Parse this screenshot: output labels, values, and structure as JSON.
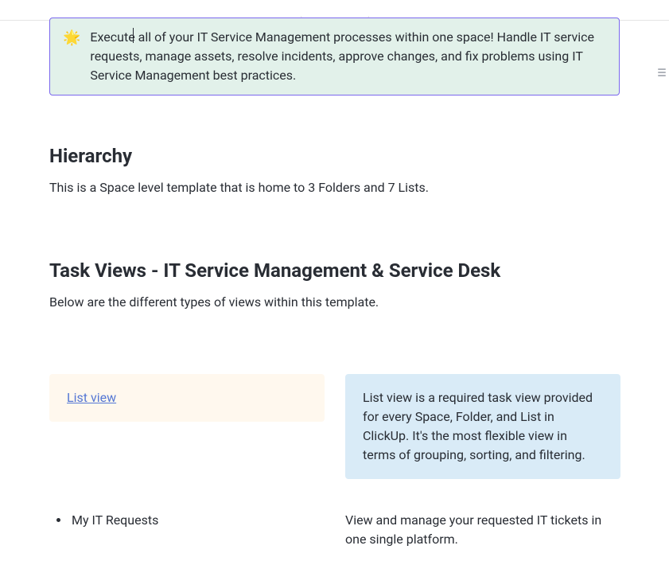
{
  "callout": {
    "icon": "🌟",
    "text": "Execute all of your IT Service Management processes within one space! Handle IT service requests, manage assets, resolve incidents, approve changes, and fix problems using IT Service Management best practices."
  },
  "hierarchy": {
    "heading": "Hierarchy",
    "body": "This is a Space level template that is home to 3 Folders and 7 Lists."
  },
  "taskviews": {
    "heading": "Task Views - IT Service Management & Service Desk",
    "body": "Below are the different types of views within this template."
  },
  "listview_card": {
    "link_label": "List view",
    "description": "List view is a required task view provided for every Space, Folder, and List in ClickUp. It's the most flexible view in terms of grouping, sorting, and filtering."
  },
  "row2": {
    "bullet": "My IT Requests",
    "description": "View and manage your requested IT tickets in one single platform."
  }
}
